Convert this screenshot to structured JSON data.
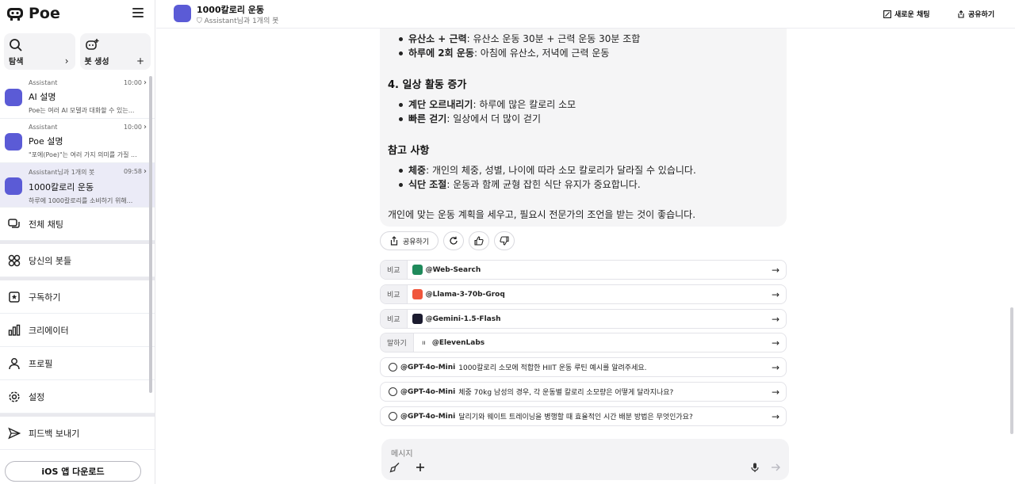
{
  "app": {
    "name": "Poe"
  },
  "quick": {
    "explore_label": "탐색",
    "create_bot_label": "봇 생성"
  },
  "chats": [
    {
      "bot": "Assistant",
      "time": "10:00",
      "title": "AI 설명",
      "snippet": "Poe는 여러 AI 모델과 대화할 수 있는..."
    },
    {
      "bot": "Assistant",
      "time": "10:00",
      "title": "Poe 설명",
      "snippet": "\"포에(Poe)\"는 여러 가지 의미를 가질 ..."
    },
    {
      "bot": "Assistant님과 1개의 봇",
      "time": "09:58",
      "title": "1000칼로리 운동",
      "snippet": "하루에 1000칼로리를 소비하기 위해..."
    }
  ],
  "nav": {
    "all_chats": "전체 채팅",
    "your_bots": "당신의 봇들",
    "subscribe": "구독하기",
    "creators": "크리에이터",
    "profile": "프로필",
    "settings": "설정",
    "feedback": "피드백 보내기"
  },
  "ios_button": "iOS 앱 다운로드",
  "header": {
    "title": "1000칼로리 운동",
    "subtitle": "Assistant님과 1개의 봇",
    "new_chat": "새로운 채팅",
    "share": "공유하기"
  },
  "message": {
    "top_bullets": [
      {
        "bold": "유산소 + 근력",
        "text": ": 유산소 운동 30분 + 근력 운동 30분 조합"
      },
      {
        "bold": "하루에 2회 운동",
        "text": ": 아침에 유산소, 저녁에 근력 운동"
      }
    ],
    "section4_title": "4. 일상 활동 증가",
    "section4_bullets": [
      {
        "bold": "계단 오르내리기",
        "text": ": 하루에 많은 칼로리 소모"
      },
      {
        "bold": "빠른 걷기",
        "text": ": 일상에서 더 많이 걷기"
      }
    ],
    "notes_title": "참고 사항",
    "notes_bullets": [
      {
        "bold": "체중",
        "text": ": 개인의 체중, 성별, 나이에 따라 소모 칼로리가 달라질 수 있습니다."
      },
      {
        "bold": "식단 조절",
        "text": ": 운동과 함께 균형 잡힌 식단 유지가 중요합니다."
      }
    ],
    "closing": "개인에 맞는 운동 계획을 세우고, 필요시 전문가의 조언을 받는 것이 좋습니다."
  },
  "actions": {
    "share_label": "공유하기"
  },
  "compare": [
    {
      "tag": "비교",
      "name": "@Web-Search",
      "color": "#1f8a5b"
    },
    {
      "tag": "비교",
      "name": "@Llama-3-70b-Groq",
      "color": "#f0563c"
    },
    {
      "tag": "비교",
      "name": "@Gemini-1.5-Flash",
      "color": "#1b1b2f"
    },
    {
      "tag": "말하기",
      "name": "@ElevenLabs",
      "color": "#ffffff"
    }
  ],
  "followups": [
    {
      "name": "@GPT-4o-Mini",
      "text": "1000칼로리 소모에 적합한 HIIT 운동 루틴 예시를 알려주세요."
    },
    {
      "name": "@GPT-4o-Mini",
      "text": "체중 70kg 남성의 경우, 각 운동별 칼로리 소모량은 어떻게 달라지나요?"
    },
    {
      "name": "@GPT-4o-Mini",
      "text": "달리기와 웨이트 트레이닝을 병행할 때 효율적인 시간 배분 방법은 무엇인가요?"
    }
  ],
  "composer": {
    "placeholder": "메시지"
  },
  "colors": {
    "accent": "#5b5bd6",
    "active_bg": "#ebebf7"
  }
}
